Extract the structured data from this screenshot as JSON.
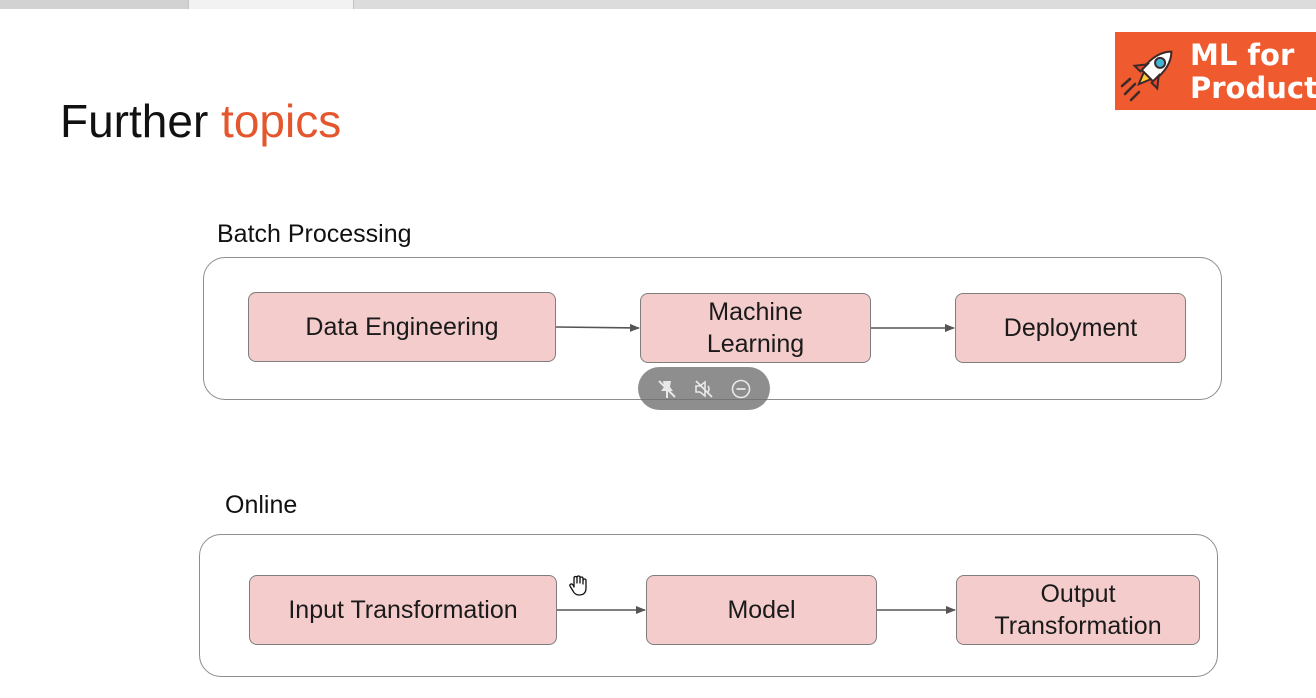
{
  "slide": {
    "title_main": "Further ",
    "title_accent": "topics"
  },
  "logo": {
    "line1": "ML for",
    "line2": "Product",
    "icon": "rocket-icon"
  },
  "batch": {
    "label": "Batch Processing",
    "nodes": [
      "Data Engineering",
      "Machine\nLearning",
      "Deployment"
    ]
  },
  "online": {
    "label": "Online",
    "nodes": [
      "Input Transformation",
      "Model",
      "Output\nTransformation"
    ]
  },
  "overlay_controls": {
    "icons": [
      "unpin-icon",
      "mute-icon",
      "minus-circle-icon"
    ]
  },
  "colors": {
    "accent": "#e4572e",
    "logo_bg": "#ef5a2f",
    "node_fill": "#f4cccc",
    "node_border": "#7e7e7e",
    "group_border": "#8d8d8d"
  }
}
